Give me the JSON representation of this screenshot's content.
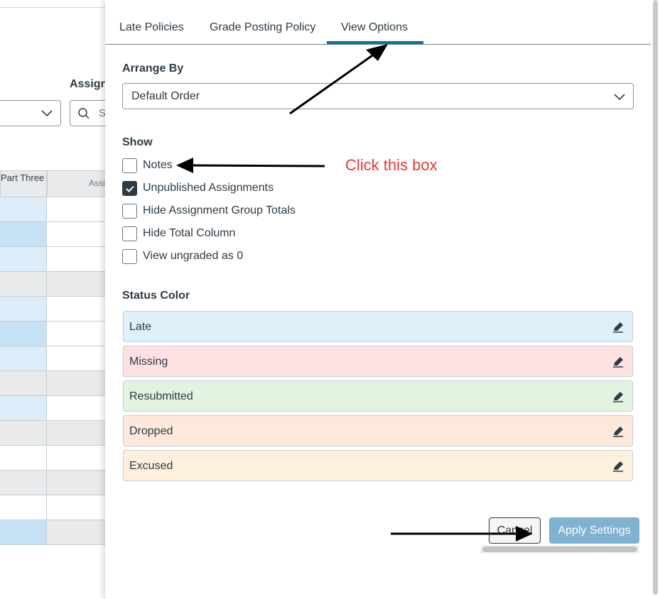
{
  "background": {
    "assignment_label": "Assignm",
    "search_placeholder": "S",
    "columns": [
      "Part Three",
      "Assi"
    ],
    "rows": [
      {
        "a": "#dcecf8",
        "b": "#ffffff"
      },
      {
        "a": "#c5e2f7",
        "b": "#ffffff"
      },
      {
        "a": "#dcecf8",
        "b": "#ffffff"
      },
      {
        "a": "#e8eaec",
        "b": "#e8eaec"
      },
      {
        "a": "#dcecf8",
        "b": "#ffffff"
      },
      {
        "a": "#c5e2f7",
        "b": "#ffffff"
      },
      {
        "a": "#dcecf8",
        "b": "#ffffff"
      },
      {
        "a": "#e8eaec",
        "b": "#e8eaec"
      },
      {
        "a": "#dcecf8",
        "b": "#ffffff"
      },
      {
        "a": "#e8eaec",
        "b": "#e8eaec"
      },
      {
        "a": "#ffffff",
        "b": "#ffffff"
      },
      {
        "a": "#e8eaec",
        "b": "#e8eaec"
      },
      {
        "a": "#ffffff",
        "b": "#ffffff"
      },
      {
        "a": "#c5e2f7",
        "b": "#e8eaec"
      }
    ]
  },
  "tabs": [
    {
      "label": "Late Policies",
      "active": false
    },
    {
      "label": "Grade Posting Policy",
      "active": false
    },
    {
      "label": "View Options",
      "active": true
    }
  ],
  "accent_color": "#0770a3",
  "arrange_by": {
    "title": "Arrange By",
    "selected": "Default Order"
  },
  "show": {
    "title": "Show",
    "options": [
      {
        "label": "Notes",
        "checked": false
      },
      {
        "label": "Unpublished Assignments",
        "checked": true
      },
      {
        "label": "Hide Assignment Group Totals",
        "checked": false
      },
      {
        "label": "Hide Total Column",
        "checked": false
      },
      {
        "label": "View ungraded as 0",
        "checked": false
      }
    ]
  },
  "status_color": {
    "title": "Status Color",
    "items": [
      {
        "label": "Late",
        "color": "#e0f0fa"
      },
      {
        "label": "Missing",
        "color": "#fde2e1"
      },
      {
        "label": "Resubmitted",
        "color": "#e1f4e1"
      },
      {
        "label": "Dropped",
        "color": "#fde8db"
      },
      {
        "label": "Excused",
        "color": "#fdf1dc"
      }
    ]
  },
  "buttons": {
    "cancel": "Cancel",
    "apply": "Apply Settings"
  },
  "annotation": {
    "text": "Click this box",
    "color": "#e8392e"
  }
}
